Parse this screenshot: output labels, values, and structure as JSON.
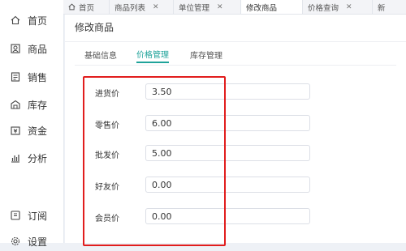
{
  "sidebar": {
    "items": [
      {
        "label": "首页",
        "icon": "home-icon"
      },
      {
        "label": "商品",
        "icon": "product-icon"
      },
      {
        "label": "销售",
        "icon": "sales-icon"
      },
      {
        "label": "库存",
        "icon": "warehouse-icon"
      },
      {
        "label": "资金",
        "icon": "money-icon"
      },
      {
        "label": "分析",
        "icon": "analytics-icon"
      },
      {
        "label": "订阅",
        "icon": "subscribe-icon"
      },
      {
        "label": "设置",
        "icon": "settings-icon"
      }
    ]
  },
  "tabs": [
    {
      "label": "首页",
      "closable": false,
      "icon": "home-icon"
    },
    {
      "label": "商品列表",
      "closable": true
    },
    {
      "label": "单位管理",
      "closable": true
    },
    {
      "label": "修改商品",
      "closable": false,
      "active": true
    },
    {
      "label": "价格查询",
      "closable": true
    },
    {
      "label": "新"
    }
  ],
  "page": {
    "title": "修改商品",
    "tabs": [
      "基础信息",
      "价格管理",
      "库存管理"
    ],
    "active_tab": "价格管理"
  },
  "form": {
    "purchase_price": {
      "label": "进货价",
      "value": "3.50"
    },
    "retail_price": {
      "label": "零售价",
      "value": "6.00"
    },
    "wholesale_price": {
      "label": "批发价",
      "value": "5.00"
    },
    "friend_price": {
      "label": "好友价",
      "value": "0.00"
    },
    "member_price": {
      "label": "会员价",
      "value": "0.00"
    }
  },
  "colors": {
    "accent": "#1fa39a",
    "highlight": "#e11d1d",
    "background": "#eef1f6"
  }
}
